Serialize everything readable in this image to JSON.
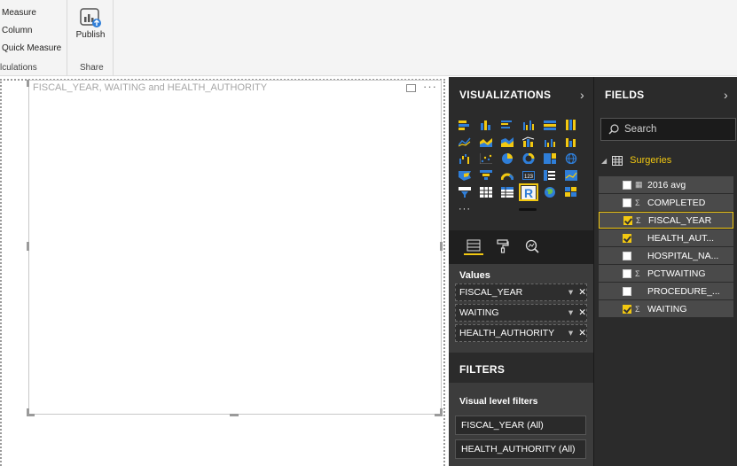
{
  "ribbon": {
    "calculations": {
      "items": [
        "Measure",
        "Column",
        "Quick Measure"
      ],
      "group_label": "lculations"
    },
    "share": {
      "publish_label": "Publish",
      "group_label": "Share"
    }
  },
  "visual": {
    "title": "FISCAL_YEAR, WAITING and HEALTH_AUTHORITY",
    "more": "···"
  },
  "visualizations": {
    "header": "VISUALIZATIONS",
    "chevron": "›",
    "more_dots": "···",
    "values_label": "Values",
    "wells": [
      {
        "label": "FISCAL_YEAR"
      },
      {
        "label": "WAITING"
      },
      {
        "label": "HEALTH_AUTHORITY"
      }
    ],
    "filters_header": "FILTERS",
    "visual_level_filters_label": "Visual level filters",
    "filters": [
      {
        "label": "FISCAL_YEAR (All)"
      },
      {
        "label": "HEALTH_AUTHORITY (All)"
      }
    ]
  },
  "fields": {
    "header": "FIELDS",
    "chevron": "›",
    "search_placeholder": "Search",
    "table_name": "Surgeries",
    "items": [
      {
        "name": "2016 avg",
        "type": "calc",
        "checked": false,
        "active": false
      },
      {
        "name": "COMPLETED",
        "type": "Σ",
        "checked": false,
        "active": false
      },
      {
        "name": "FISCAL_YEAR",
        "type": "Σ",
        "checked": true,
        "active": true
      },
      {
        "name": "HEALTH_AUT...",
        "type": "",
        "checked": true,
        "active": false
      },
      {
        "name": "HOSPITAL_NA...",
        "type": "",
        "checked": false,
        "active": false
      },
      {
        "name": "PCTWAITING",
        "type": "Σ",
        "checked": false,
        "active": false
      },
      {
        "name": "PROCEDURE_...",
        "type": "",
        "checked": false,
        "active": false
      },
      {
        "name": "WAITING",
        "type": "Σ",
        "checked": true,
        "active": false
      }
    ]
  },
  "colors": {
    "accent": "#f2c811",
    "pane_bg": "#2b2b2b",
    "viz_blue": "#2f7ed8",
    "viz_yellow": "#f2c811"
  }
}
